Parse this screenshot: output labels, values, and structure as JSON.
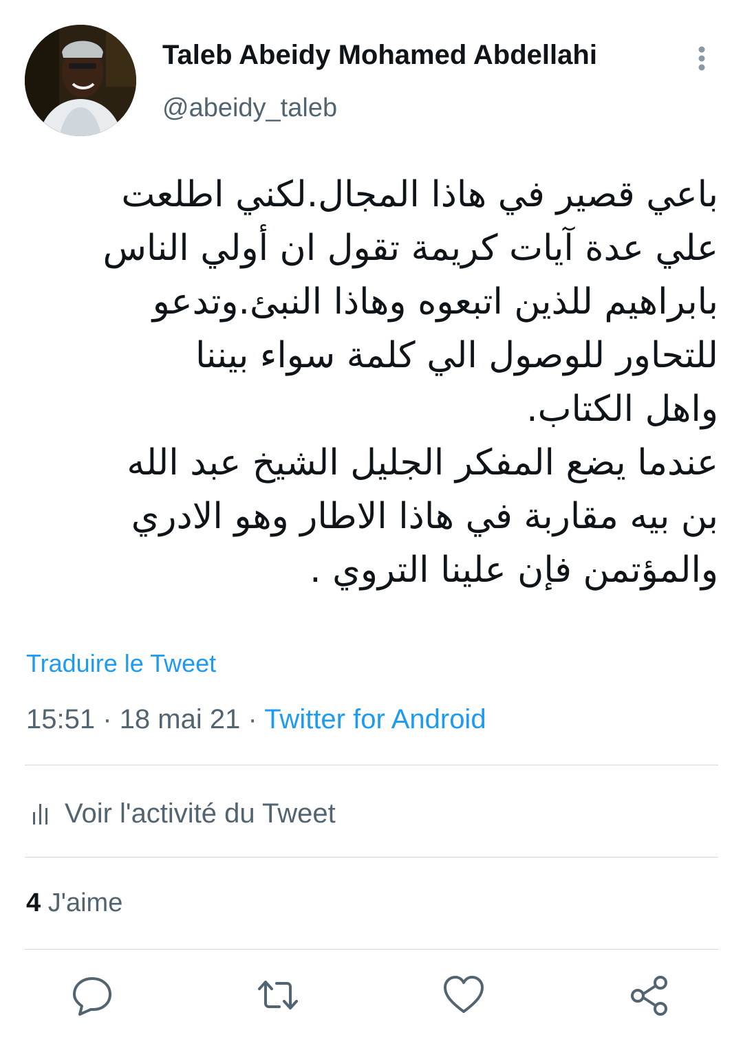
{
  "tweet": {
    "author": {
      "display_name": "Taleb Abeidy Mohamed Abdellahi",
      "handle": "@abeidy_taleb"
    },
    "body_lines": [
      "باعي قصير في هاذا المجال.لكني اطلعت",
      "علي عدة آيات كريمة تقول ان أولي الناس",
      "بابراهيم للذين  اتبعوه وهاذا النبئ.وتدعو",
      "للتحاور للوصول الي كلمة سواء بيننا",
      "واهل الكتاب.",
      "عندما يضع المفكر الجليل الشيخ عبد الله",
      "بن بيه  مقاربة في هاذا الاطار وهو الادري",
      "والمؤتمن فإن علينا التروي ."
    ],
    "translate_label": "Traduire le Tweet",
    "time": "15:51",
    "date": "18 mai 21",
    "separator": "·",
    "source": "Twitter for Android",
    "activity_label": "Voir l'activité du Tweet",
    "likes_count": "4",
    "likes_label": "J'aime"
  },
  "icons": {
    "more": "vertical-dots-icon",
    "activity": "bar-chart-icon",
    "reply": "speech-bubble-icon",
    "retweet": "retweet-arrows-icon",
    "like": "heart-icon",
    "share": "share-nodes-icon"
  },
  "colors": {
    "text_primary": "#0f1419",
    "text_secondary": "#536471",
    "link_blue": "#1d9bf0",
    "divider": "#cfd9de"
  }
}
